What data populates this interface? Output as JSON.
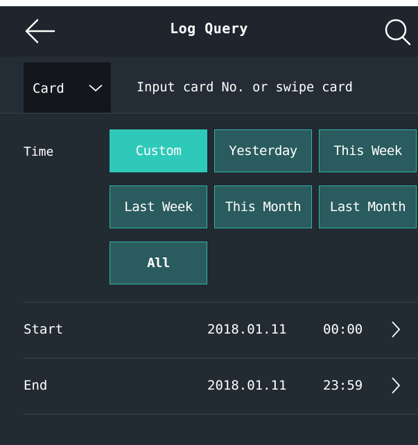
{
  "header": {
    "title": "Log Query",
    "back_icon": "arrow-left-icon",
    "search_icon": "search-icon"
  },
  "search": {
    "type_selected": "Card",
    "type_icon": "chevron-down-icon",
    "placeholder": "Input card No. or swipe card"
  },
  "time": {
    "label": "Time",
    "selected": "Custom",
    "options": [
      {
        "label": "Custom"
      },
      {
        "label": "Yesterday"
      },
      {
        "label": "This Week"
      },
      {
        "label": "Last Week"
      },
      {
        "label": "This Month"
      },
      {
        "label": "Last Month"
      },
      {
        "label": "All"
      }
    ]
  },
  "start": {
    "label": "Start",
    "date": "2018.01.11",
    "time": "00:00",
    "icon": "chevron-right-icon"
  },
  "end": {
    "label": "End",
    "date": "2018.01.11",
    "time": "23:59",
    "icon": "chevron-right-icon"
  },
  "colors": {
    "background": "#222a32",
    "header": "#1f252c",
    "accent": "#2ec9b9",
    "option_fill": "#2a5b5e",
    "option_border": "#2fb6a7"
  }
}
